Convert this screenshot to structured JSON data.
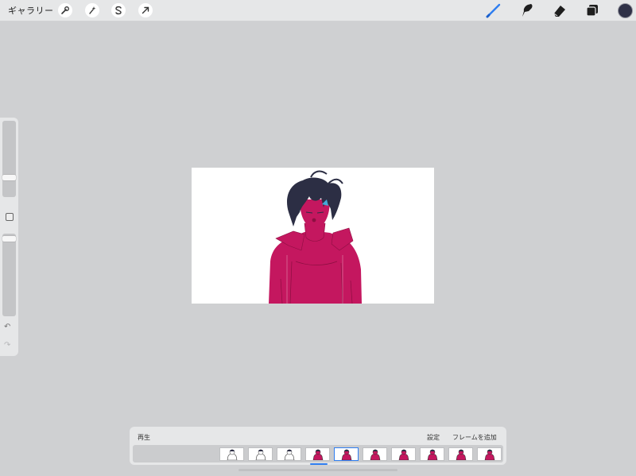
{
  "topbar": {
    "gallery_label": "ギャラリー",
    "left_tools": [
      {
        "icon": "wrench-icon"
      },
      {
        "icon": "magic-wand-icon"
      },
      {
        "icon": "selection-s-icon"
      },
      {
        "icon": "transform-arrow-icon"
      }
    ],
    "right_tools": [
      {
        "icon": "brush-icon",
        "active": true
      },
      {
        "icon": "smudge-icon",
        "active": false
      },
      {
        "icon": "eraser-icon",
        "active": false
      },
      {
        "icon": "layers-icon",
        "active": false
      }
    ],
    "color": "#2f3147",
    "accent": "#2f7ef0"
  },
  "sidebar": {
    "brush_size_level": 0.24,
    "opacity_level": 0.97
  },
  "animation": {
    "play_label": "再生",
    "settings_label": "設定",
    "add_frame_label": "フレームを追加",
    "frame_count": 10,
    "selected_frame": 4
  },
  "artwork": {
    "jacket_color": "#c4175f",
    "hair_color": "#2c2e44",
    "accent_color": "#46a8d8"
  }
}
